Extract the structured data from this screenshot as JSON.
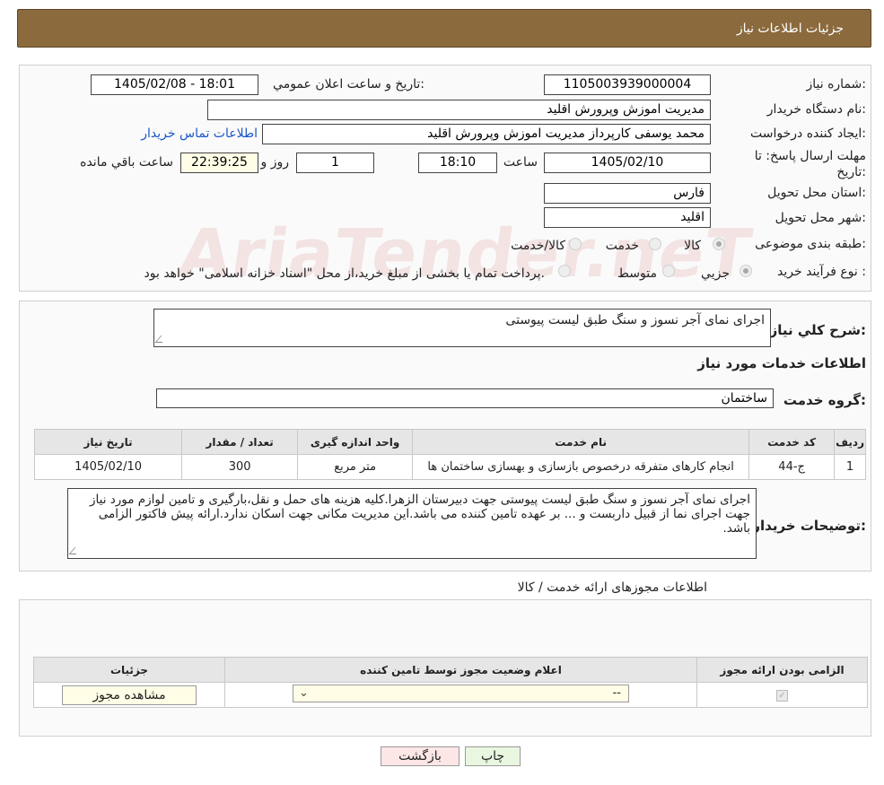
{
  "header": {
    "title": "جزئیات اطلاعات نیاز"
  },
  "fields": {
    "need_number_label": "شماره نیاز:",
    "need_number": "1105003939000004",
    "announce_label": "تاریخ و ساعت اعلان عمومي:",
    "announce_value": "1405/02/08 - 18:01",
    "buyer_org_label": "نام دستگاه خریدار:",
    "buyer_org": "مدیریت اموزش وپرورش اقلید",
    "creator_label": "ایجاد کننده درخواست:",
    "creator": "محمد یوسفی کارپرداز مدیریت اموزش وپرورش اقلید",
    "contact_link": "اطلاعات تماس خریدار",
    "deadline_label_line1": "مهلت ارسال پاسخ: تا",
    "deadline_label_line2": "تاریخ:",
    "deadline_date": "1405/02/10",
    "time_label": "ساعت",
    "deadline_time": "18:10",
    "days_value": "1",
    "days_label": "روز و",
    "remaining_time": "22:39:25",
    "remaining_label": "ساعت باقي مانده",
    "province_label": "استان محل تحویل:",
    "province": "فارس",
    "city_label": "شهر محل تحویل:",
    "city": "اقلید",
    "category_label": "طبقه بندی موضوعی:",
    "category_options": [
      "کالا",
      "خدمت",
      "کالا/خدمت"
    ],
    "process_label": "نوع فرآیند خرید :",
    "process_options": [
      "جزيي",
      "متوسط"
    ],
    "process_note": "پرداخت تمام یا بخشی از مبلغ خرید،از محل \"اسناد خزانه اسلامی\" خواهد بود."
  },
  "description": {
    "label": "شرح کلي نياز:",
    "text": "اجرای نمای آجر نسوز و سنگ طبق لیست پیوستی"
  },
  "services": {
    "section_title": "اطلاعات خدمات مورد نياز",
    "group_label": "گروه خدمت:",
    "group_value": "ساختمان",
    "table": {
      "headers": [
        "رديف",
        "کد خدمت",
        "نام خدمت",
        "واحد اندازه گيری",
        "تعداد / مقدار",
        "تاريخ نياز"
      ],
      "rows": [
        [
          "1",
          "ج-44",
          "انجام کارهای متفرقه درخصوص بازسازی و بهسازی ساختمان ها",
          "متر مربع",
          "300",
          "1405/02/10"
        ]
      ]
    }
  },
  "buyer_notes": {
    "label": "توضیحات خریدار:",
    "text": "اجرای نمای آجر نسوز و سنگ طبق لیست پیوستی جهت دبیرستان الزهرا.کلیه هزینه های حمل و نقل،بارگیری و تامین لوازم مورد نیاز جهت اجرای نما از قبیل داربست و ... بر عهده تامین کننده می باشد.این مدیریت مکانی جهت اسکان ندارد.ارائه پیش فاکتور الزامی باشد."
  },
  "permits": {
    "section_title": "اطلاعات مجوزهای ارائه خدمت / کالا",
    "headers": [
      "الزامی بودن ارائه مجوز",
      "اعلام وضعیت مجوز توسط تامین کننده",
      "جزئیات"
    ],
    "select_value": "--",
    "view_button": "مشاهده مجوز"
  },
  "buttons": {
    "print": "چاپ",
    "back": "بازگشت"
  },
  "watermark": "AriaTender.neT"
}
